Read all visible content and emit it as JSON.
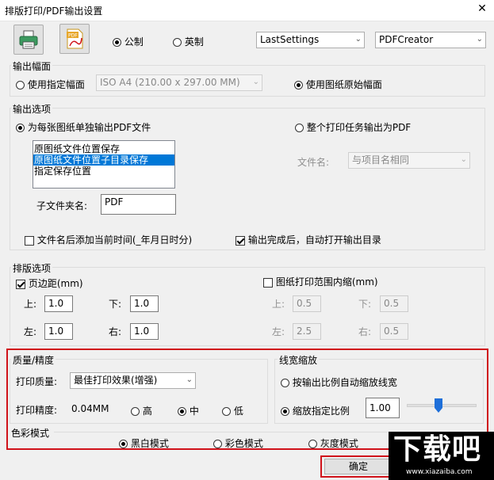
{
  "window": {
    "title": "排版打印/PDF输出设置",
    "close": "✕"
  },
  "toolbar": {
    "print_icon": "printer-icon",
    "pdf_icon": "pdf-document-icon",
    "pdf_badge": "PDF",
    "unit_metric": "公制",
    "unit_imperial": "英制",
    "unit_selected": "公制",
    "settings_select": "LastSettings",
    "printer_select": "PDFCreator"
  },
  "output_size": {
    "group_label": "输出幅面",
    "use_specified": "使用指定幅面",
    "paper_select": "ISO A4 (210.00 x 297.00 MM)",
    "use_original": "使用图纸原始幅面",
    "selected": "使用图纸原始幅面"
  },
  "output_options": {
    "group_label": "输出选项",
    "per_sheet": "为每张图纸单独输出PDF文件",
    "whole_job": "整个打印任务输出为PDF",
    "selected": "为每张图纸单独输出PDF文件",
    "location_list": [
      "原图纸文件位置保存",
      "原图纸文件位置子目录保存",
      "指定保存位置"
    ],
    "location_selected_index": 1,
    "subfolder_label": "子文件夹名:",
    "subfolder_value": "PDF",
    "filename_label": "文件名:",
    "filename_select": "与项目名相同",
    "append_time_label": "文件名后添加当前时间(_年月日时分)",
    "append_time_checked": false,
    "open_dir_label": "输出完成后，自动打开输出目录",
    "open_dir_checked": true
  },
  "layout_options": {
    "group_label": "排版选项",
    "page_margin_label": "页边距(mm)",
    "page_margin_checked": true,
    "margin_top_label": "上:",
    "margin_top": "1.0",
    "margin_bottom_label": "下:",
    "margin_bottom": "1.0",
    "margin_left_label": "左:",
    "margin_left": "1.0",
    "margin_right_label": "右:",
    "margin_right": "1.0",
    "inner_shrink_label": "图纸打印范围内缩(mm)",
    "inner_shrink_checked": false,
    "shrink_top_label": "上:",
    "shrink_top": "0.5",
    "shrink_bottom_label": "下:",
    "shrink_bottom": "0.5",
    "shrink_left_label": "左:",
    "shrink_left": "2.5",
    "shrink_right_label": "右:",
    "shrink_right": "0.5"
  },
  "quality": {
    "group_label": "质量/精度",
    "print_quality_label": "打印质量:",
    "print_quality_select": "最佳打印效果(增强)",
    "precision_label": "打印精度:",
    "precision_value": "0.04MM",
    "precision_high": "高",
    "precision_mid": "中",
    "precision_low": "低",
    "precision_selected": "中"
  },
  "line_width": {
    "group_label": "线宽缩放",
    "auto_label": "按输出比例自动缩放线宽",
    "specified_label": "缩放指定比例",
    "selected": "缩放指定比例",
    "scale_value": "1.00",
    "slider_level": 0.45
  },
  "color_mode": {
    "group_label": "色彩模式",
    "mono": "黑白模式",
    "color": "彩色模式",
    "gray": "灰度模式",
    "selected": "黑白模式"
  },
  "footer": {
    "ok_label": "确定"
  },
  "watermark": {
    "logo_text": "下载吧",
    "url_text": "www.xiazaiba.com"
  },
  "colors": {
    "highlight_red": "#d0121a",
    "selection_blue": "#0078d7",
    "slider_blue": "#1e6fd9"
  }
}
